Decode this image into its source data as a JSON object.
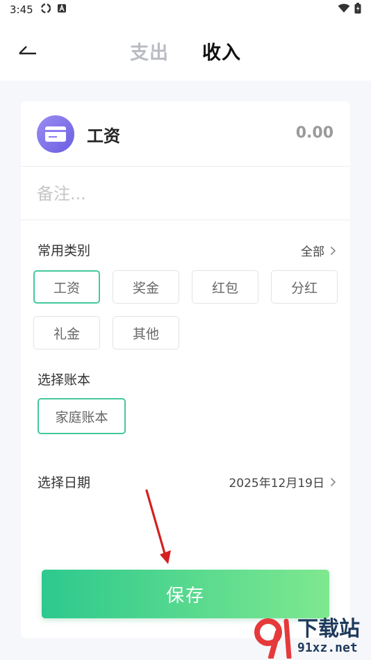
{
  "status_bar": {
    "time": "3:45",
    "icons": [
      "sync-icon",
      "a-badge-icon",
      "wifi-icon",
      "battery-icon"
    ]
  },
  "header": {
    "tabs": [
      {
        "label": "支出",
        "active": false
      },
      {
        "label": "收入",
        "active": true
      }
    ]
  },
  "entry": {
    "category_icon": "card-icon",
    "category_name": "工资",
    "amount": "0.00",
    "note_placeholder": "备注..."
  },
  "categories": {
    "title": "常用类别",
    "all_label": "全部",
    "items": [
      {
        "label": "工资",
        "selected": true
      },
      {
        "label": "奖金",
        "selected": false
      },
      {
        "label": "红包",
        "selected": false
      },
      {
        "label": "分红",
        "selected": false
      },
      {
        "label": "礼金",
        "selected": false
      },
      {
        "label": "其他",
        "selected": false
      }
    ]
  },
  "account_book": {
    "title": "选择账本",
    "selected": "家庭账本"
  },
  "date": {
    "title": "选择日期",
    "value": "2025年12月19日"
  },
  "save_label": "保存",
  "watermark": {
    "title": "下载站",
    "url": "91xz.net"
  },
  "colors": {
    "accent": "#44c99b",
    "save_gradient_start": "#2dc98e",
    "save_gradient_end": "#7fe88f",
    "category_icon_bg": "#7f70ea",
    "annotation_arrow": "#d42020"
  }
}
